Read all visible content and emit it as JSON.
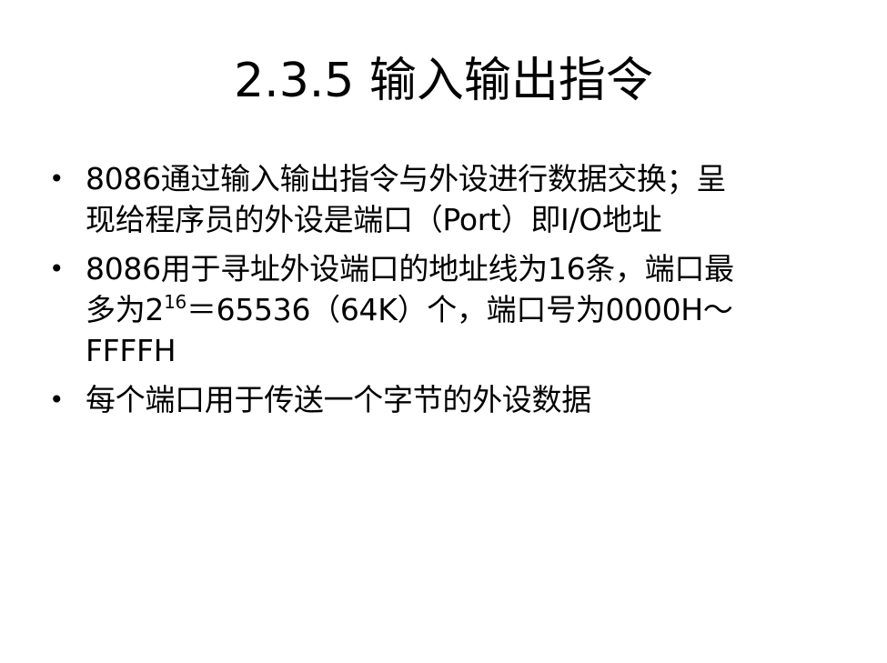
{
  "slide": {
    "title": "2.3.5  输入输出指令",
    "bullet_symbol": "•",
    "bullets": [
      {
        "line1": "8086通过输入输出指令与外设进行数据交换；呈",
        "line2": "现给程序员的外设是端口（Port）即I/O地址"
      },
      {
        "line1": "8086用于寻址外设端口的地址线为16条，端口最",
        "line2_pre": "多为2",
        "line2_sup": "16",
        "line2_post": "＝65536（64K）个，端口号为0000H～",
        "line3": "FFFFH"
      },
      {
        "line1": "每个端口用于传送一个字节的外设数据"
      }
    ]
  }
}
